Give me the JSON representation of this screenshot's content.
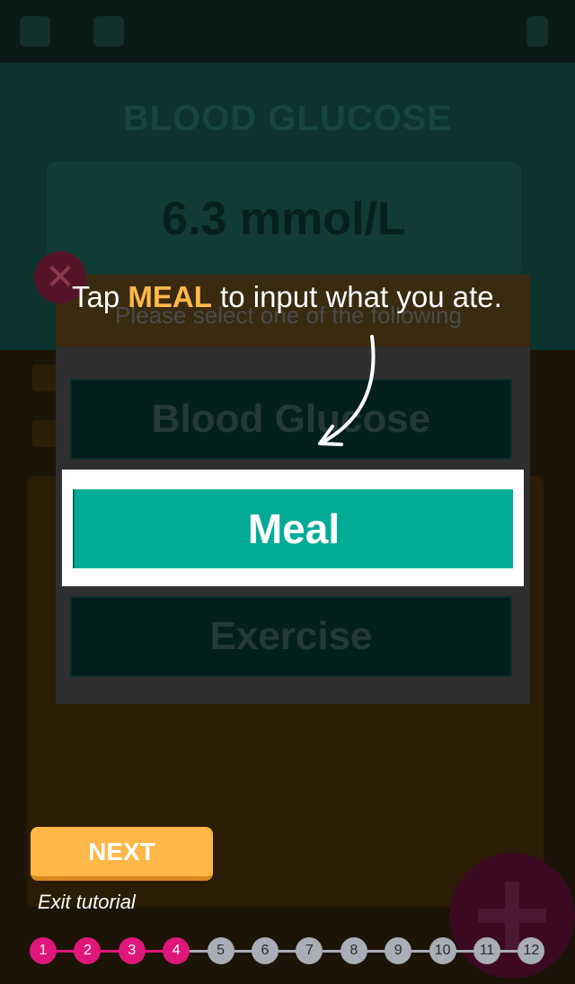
{
  "background": {
    "section_title": "BLOOD GLUCOSE",
    "reading": "6.3 mmol/L"
  },
  "dialog": {
    "header": "Please select one of the following",
    "options": [
      "Blood Glucose",
      "Meal",
      "Exercise"
    ],
    "close_icon": "close-icon"
  },
  "tutorial": {
    "tip_prefix": "Tap ",
    "tip_highlight": "MEAL",
    "tip_suffix": " to input what you ate.",
    "next_label": "NEXT",
    "exit_label": "Exit tutorial",
    "current_step": 4,
    "steps": [
      "1",
      "2",
      "3",
      "4",
      "5",
      "6",
      "7",
      "8",
      "9",
      "10",
      "11",
      "12"
    ]
  },
  "colors": {
    "accent_teal": "#02ab98",
    "highlight_orange": "#ffb84a",
    "step_done": "#e0177a",
    "step_todo": "#a9adb5"
  }
}
